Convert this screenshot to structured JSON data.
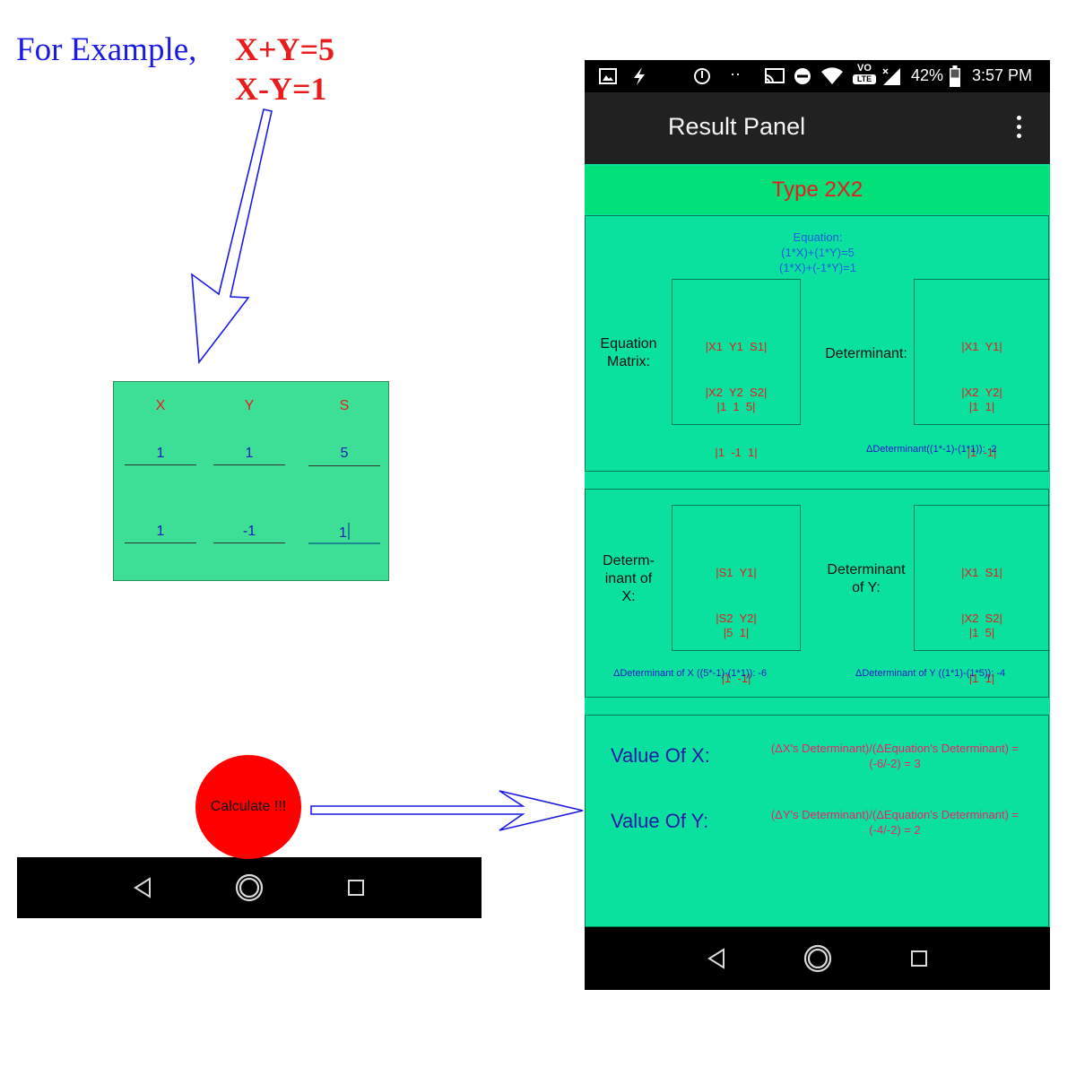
{
  "example": {
    "prefix": "For Example,",
    "eq1": "X+Y=5",
    "eq2": "X-Y=1"
  },
  "input_card": {
    "headers": [
      "X",
      "Y",
      "S"
    ],
    "row1": [
      "1",
      "1",
      "5"
    ],
    "row2": [
      "1",
      "-1",
      "1"
    ]
  },
  "calculate_label": "Calculate !!!",
  "status_bar": {
    "battery": "42%",
    "time": "3:57 PM",
    "volte_top": "VO",
    "volte_bottom": "LTE"
  },
  "app_bar": {
    "title": "Result Panel"
  },
  "type_label": "Type 2X2",
  "panel1": {
    "equation_title": "Equation:",
    "equation_line1": "(1*X)+(1*Y)=5",
    "equation_line2": "(1*X)+(-1*Y)=1",
    "matrix_label_1": "Equation",
    "matrix_label_2": "Matrix:",
    "matrix_sym_1": "|X1  Y1  S1|",
    "matrix_sym_2": "|X2  Y2  S2|",
    "matrix_num_1": "|1  1  5|",
    "matrix_num_2": "|1  -1  1|",
    "det_label": "Determinant:",
    "det_sym_1": "|X1  Y1|",
    "det_sym_2": "|X2  Y2|",
    "det_num_1": "|1  1|",
    "det_num_2": "|1  -1|",
    "det_result": "ΔDeterminant((1*-1)-(1*1)): -2"
  },
  "panel2": {
    "dx_label_1": "Determ-",
    "dx_label_2": "inant of",
    "dx_label_3": "X:",
    "dx_sym_1": "|S1  Y1|",
    "dx_sym_2": "|S2  Y2|",
    "dx_num_1": "|5  1|",
    "dx_num_2": "|1  -1|",
    "dy_label_1": "Determinant",
    "dy_label_2": "of Y:",
    "dy_sym_1": "|X1  S1|",
    "dy_sym_2": "|X2  S2|",
    "dy_num_1": "|1  5|",
    "dy_num_2": "|1  1|",
    "dx_result": "ΔDeterminant of X ((5*-1)-(1*1)): -6",
    "dy_result": "ΔDeterminant of Y ((1*1)-(1*5)): -4"
  },
  "panel3": {
    "x_label": "Value Of X:",
    "x_formula_1": "(ΔX's Determinant)/(ΔEquation's Determinant) =",
    "x_formula_2": "(-6/-2) = 3",
    "y_label": "Value Of Y:",
    "y_formula_1": "(ΔY's Determinant)/(ΔEquation's Determinant) =",
    "y_formula_2": "(-4/-2) = 2"
  },
  "colors": {
    "card_green": "#3ddf96",
    "phone_green": "#0be19e",
    "type_band": "#02e07a",
    "arrow_blue": "#1a1ae6",
    "accent_red": "#e81c1c"
  }
}
